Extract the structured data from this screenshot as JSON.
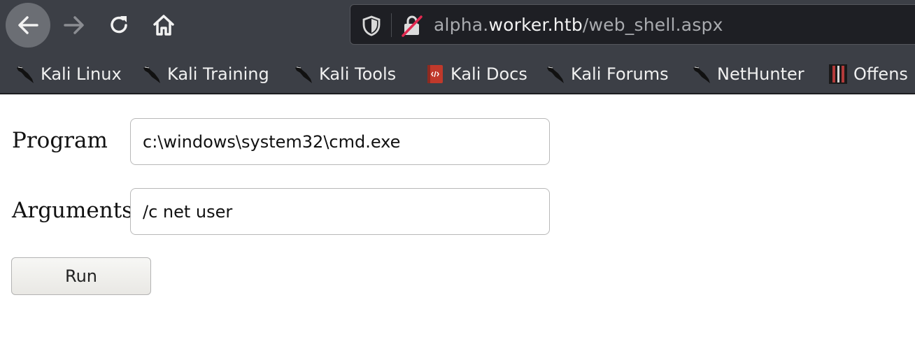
{
  "browser": {
    "url": {
      "prefix": "alpha.",
      "host": "worker.htb",
      "path": "/web_shell.aspx"
    },
    "bookmarks": [
      {
        "label": "Kali Linux",
        "icon": "kali-dragon-icon"
      },
      {
        "label": "Kali Training",
        "icon": "kali-dragon-icon"
      },
      {
        "label": "Kali Tools",
        "icon": "kali-dragon-icon"
      },
      {
        "label": "Kali Docs",
        "icon": "docs-book-icon"
      },
      {
        "label": "Kali Forums",
        "icon": "kali-dragon-icon"
      },
      {
        "label": "NetHunter",
        "icon": "kali-dragon-icon"
      },
      {
        "label": "Offens",
        "icon": "offsec-icon"
      }
    ]
  },
  "form": {
    "program_label": "Program",
    "program_value": "c:\\windows\\system32\\cmd.exe",
    "arguments_label": "Arguments",
    "arguments_value": "/c net user",
    "run_label": "Run"
  },
  "colors": {
    "chrome_bg": "#3c3f46",
    "url_bg": "#1e1f24",
    "lock_strike": "#e22850"
  }
}
